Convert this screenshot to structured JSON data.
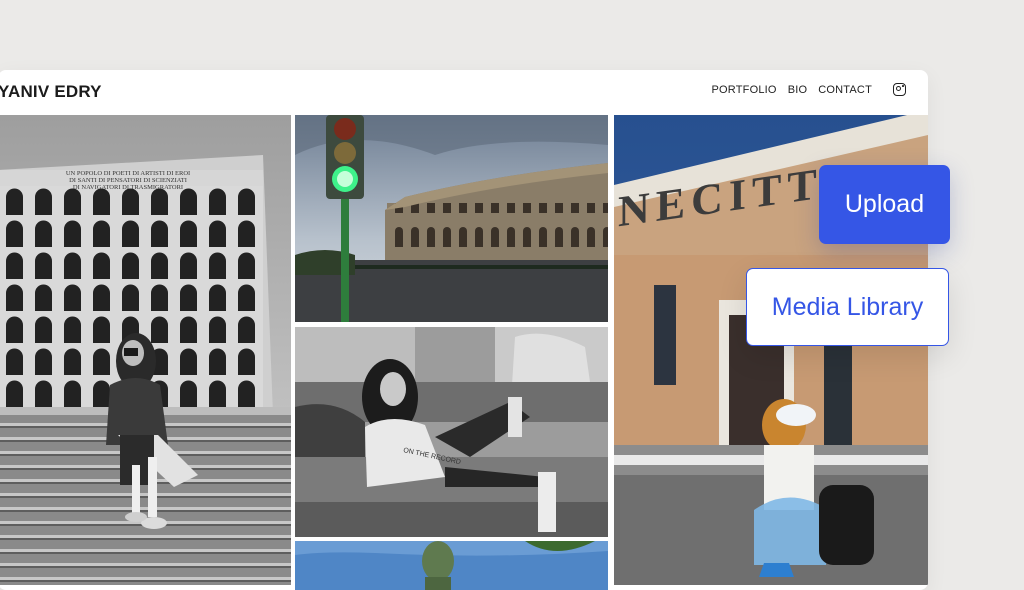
{
  "site": {
    "brand": "YANIV EDRY",
    "nav": [
      "PORTFOLIO",
      "BIO",
      "CONTACT"
    ],
    "social_icon": "instagram-icon"
  },
  "building_inscription": {
    "line1": "UN POPOLO DI POETI DI ARTISTI DI EROI",
    "line2": "DI SANTI DI PENSATORI DI SCIENZIATI",
    "line3": "DI NAVIGATORI DI TRASMIGRATORI"
  },
  "studio_sign": "NECITTA",
  "tshirt_text": "ON THE RECORD",
  "actions": {
    "upload_label": "Upload",
    "media_library_label": "Media Library"
  },
  "colors": {
    "accent": "#3556e6",
    "background": "#ebeae8"
  }
}
